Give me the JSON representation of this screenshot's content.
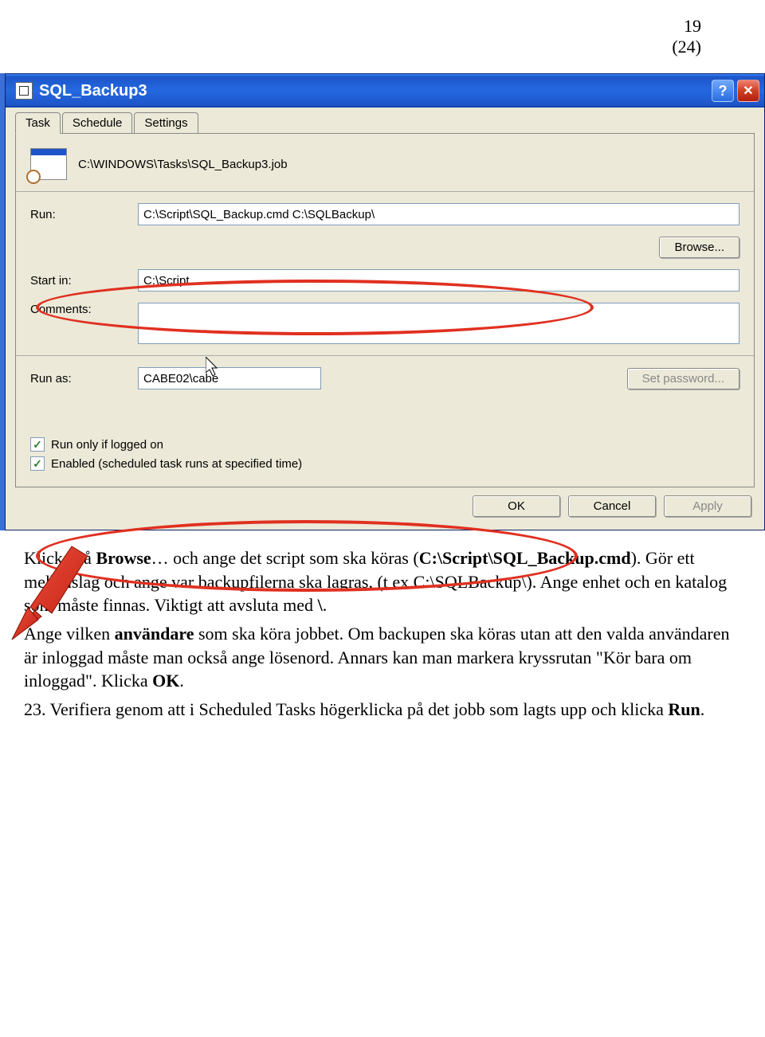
{
  "page": {
    "num": "19",
    "of": "(24)"
  },
  "dialog": {
    "title": "SQL_Backup3",
    "tabs": [
      "Task",
      "Schedule",
      "Settings"
    ],
    "job_path": "C:\\WINDOWS\\Tasks\\SQL_Backup3.job",
    "run_label": "Run:",
    "run_value": "C:\\Script\\SQL_Backup.cmd C:\\SQLBackup\\",
    "browse_btn": "Browse...",
    "startin_label": "Start in:",
    "startin_value": "C:\\Script",
    "comments_label": "Comments:",
    "comments_value": "",
    "runas_label": "Run as:",
    "runas_value": "CABE02\\cabe",
    "setpass_btn": "Set password...",
    "check1": "Run only if logged on",
    "check2": "Enabled (scheduled task runs at specified time)",
    "ok": "OK",
    "cancel": "Cancel",
    "apply": "Apply"
  },
  "text": {
    "p1a": "Klicka på ",
    "p1b": "Browse",
    "p1c": "… och ange det script som ska köras (",
    "p1d": "C:\\Script\\SQL_Backup.cmd",
    "p1e": "). Gör ett mellanslag och ange var backupfilerna ska lagras, (t ex C:\\SQLBackup\\). Ange enhet och en katalog som måste finnas. Viktigt att avsluta med ",
    "p1f": "\\",
    "p1g": ".",
    "p2a": "Ange vilken ",
    "p2b": "användare",
    "p2c": " som ska köra jobbet. Om backupen ska köras utan att den valda användaren är inloggad måste man också ange lösenord. Annars kan man markera kryssrutan \"Kör bara om inloggad\". Klicka ",
    "p2d": "OK",
    "p2e": ".",
    "p3a": "23. Verifiera genom att i Scheduled Tasks högerklicka på det jobb som lagts upp och klicka ",
    "p3b": "Run",
    "p3c": "."
  }
}
